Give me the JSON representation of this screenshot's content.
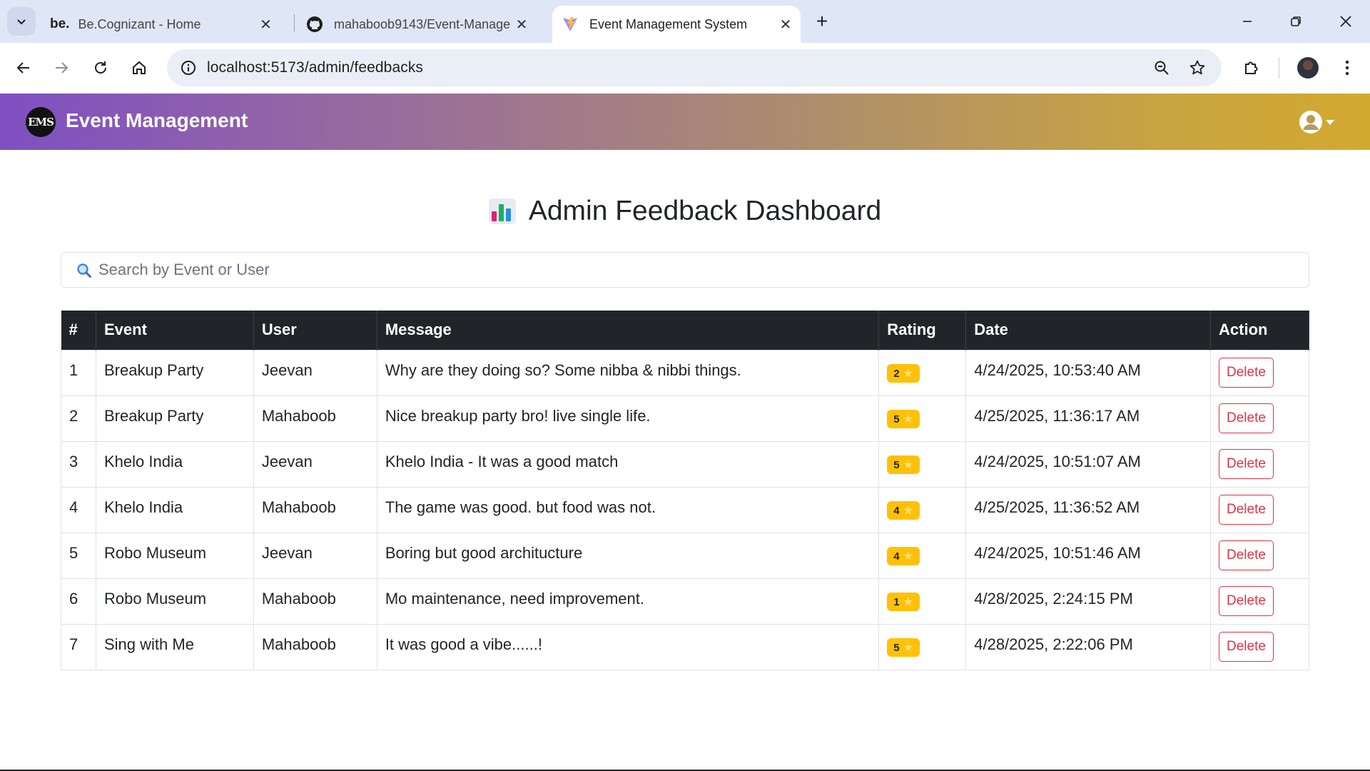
{
  "browser": {
    "tabs": [
      {
        "favicon": "be.",
        "title": "Be.Cognizant - Home"
      },
      {
        "favicon": "github-icon",
        "title": "mahaboob9143/Event-Manage"
      },
      {
        "favicon": "vite-icon",
        "title": "Event Management System"
      }
    ],
    "url": "localhost:5173/admin/feedbacks"
  },
  "navbar": {
    "logo_text": "EMS",
    "brand": "Event Management"
  },
  "page": {
    "title": "Admin Feedback Dashboard",
    "search_placeholder": "Search by Event or User"
  },
  "table": {
    "headers": [
      "#",
      "Event",
      "User",
      "Message",
      "Rating",
      "Date",
      "Action"
    ],
    "rows": [
      {
        "num": "1",
        "event": "Breakup Party",
        "user": "Jeevan",
        "message": "Why are they doing so? Some nibba & nibbi things.",
        "rating": "2",
        "date": "4/24/2025, 10:53:40 AM",
        "action": "Delete"
      },
      {
        "num": "2",
        "event": "Breakup Party",
        "user": "Mahaboob",
        "message": "Nice breakup party bro! live single life.",
        "rating": "5",
        "date": "4/25/2025, 11:36:17 AM",
        "action": "Delete"
      },
      {
        "num": "3",
        "event": "Khelo India",
        "user": "Jeevan",
        "message": "Khelo India - It was a good match",
        "rating": "5",
        "date": "4/24/2025, 10:51:07 AM",
        "action": "Delete"
      },
      {
        "num": "4",
        "event": "Khelo India",
        "user": "Mahaboob",
        "message": "The game was good. but food was not.",
        "rating": "4",
        "date": "4/25/2025, 11:36:52 AM",
        "action": "Delete"
      },
      {
        "num": "5",
        "event": "Robo Museum",
        "user": "Jeevan",
        "message": "Boring but good architucture",
        "rating": "4",
        "date": "4/24/2025, 10:51:46 AM",
        "action": "Delete"
      },
      {
        "num": "6",
        "event": "Robo Museum",
        "user": "Mahaboob",
        "message": "Mo maintenance, need improvement.",
        "rating": "1",
        "date": "4/28/2025, 2:24:15 PM",
        "action": "Delete"
      },
      {
        "num": "7",
        "event": "Sing with Me",
        "user": "Mahaboob",
        "message": "It was good a vibe......!",
        "rating": "5",
        "date": "4/28/2025, 2:22:06 PM",
        "action": "Delete"
      }
    ]
  },
  "colors": {
    "navbar_gradient_start": "#7f4fc2",
    "navbar_gradient_end": "#d2a92f",
    "table_header_bg": "#212529",
    "rating_badge": "#ffc107",
    "delete_button": "#dc3545"
  }
}
